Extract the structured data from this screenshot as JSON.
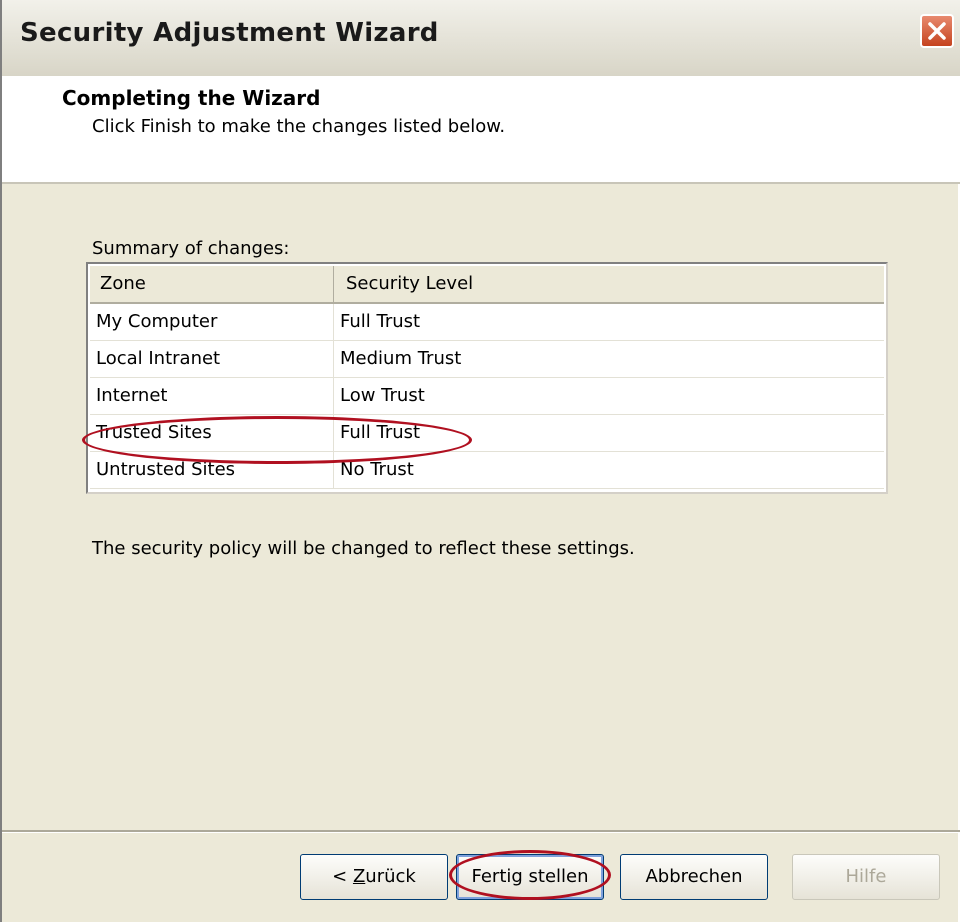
{
  "window": {
    "title": "Security Adjustment Wizard"
  },
  "header": {
    "title": "Completing the Wizard",
    "subtitle": "Click Finish to make the changes listed below."
  },
  "summary": {
    "label": "Summary of changes:",
    "columns": [
      "Zone",
      "Security Level"
    ],
    "rows": [
      {
        "zone": "My Computer",
        "level": "Full Trust"
      },
      {
        "zone": "Local Intranet",
        "level": "Medium Trust"
      },
      {
        "zone": "Internet",
        "level": "Low Trust"
      },
      {
        "zone": "Trusted Sites",
        "level": "Full Trust"
      },
      {
        "zone": "Untrusted Sites",
        "level": "No Trust"
      }
    ]
  },
  "policy_text": "The security policy will be changed to reflect these settings.",
  "buttons": {
    "back_prefix": "< ",
    "back_accel": "Z",
    "back_rest": "urück",
    "finish": "Fertig stellen",
    "cancel": "Abbrechen",
    "help": "Hilfe"
  },
  "colors": {
    "annotation": "#b01020",
    "close_button": "#c5431f"
  }
}
